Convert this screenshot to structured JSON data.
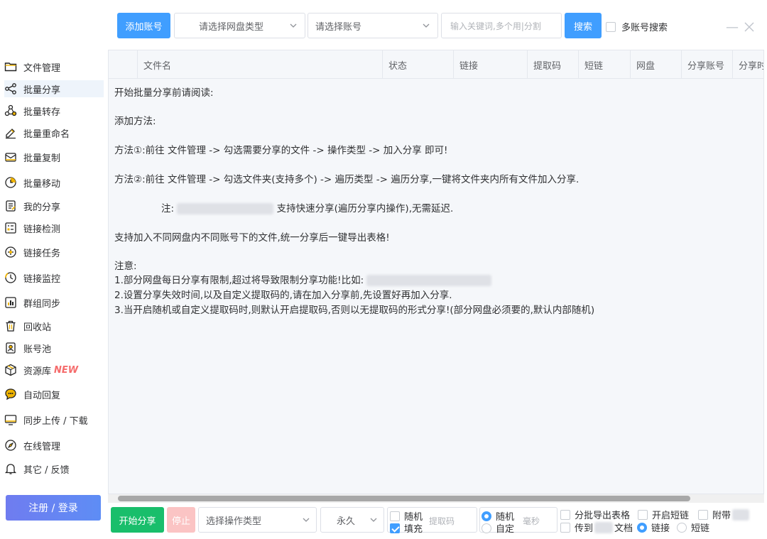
{
  "toolbar": {
    "add_account": "添加账号",
    "disk_type_placeholder": "请选择网盘类型",
    "account_placeholder": "请选择账号",
    "keyword_placeholder": "输入关键词,多个用|分割",
    "search": "搜索",
    "multi_account_search": "多账号搜索"
  },
  "sidebar": {
    "items": [
      {
        "label": "文件管理",
        "icon": "folder-icon"
      },
      {
        "label": "批量分享",
        "icon": "share-icon"
      },
      {
        "label": "批量转存",
        "icon": "transfer-icon"
      },
      {
        "label": "批量重命名",
        "icon": "rename-icon"
      },
      {
        "label": "批量复制",
        "icon": "copy-icon"
      },
      {
        "label": "批量移动",
        "icon": "move-icon"
      },
      {
        "label": "我的分享",
        "icon": "my-share-icon"
      },
      {
        "label": "链接检测",
        "icon": "link-check-icon"
      },
      {
        "label": "链接任务",
        "icon": "link-task-icon"
      },
      {
        "label": "链接监控",
        "icon": "link-monitor-icon"
      },
      {
        "label": "群组同步",
        "icon": "group-sync-icon"
      },
      {
        "label": "回收站",
        "icon": "trash-icon"
      },
      {
        "label": "账号池",
        "icon": "account-pool-icon"
      },
      {
        "label": "资源库",
        "icon": "resource-icon",
        "badge": "NEW"
      },
      {
        "label": "自动回复",
        "icon": "auto-reply-icon"
      },
      {
        "label": "同步上传 / 下载",
        "icon": "sync-icon"
      },
      {
        "label": "在线管理",
        "icon": "online-icon"
      },
      {
        "label": "其它 / 反馈",
        "icon": "bell-icon"
      }
    ],
    "login": "注册 / 登录"
  },
  "table": {
    "columns": [
      "文件名",
      "状态",
      "链接",
      "提取码",
      "短链",
      "网盘",
      "分享账号",
      "分享时"
    ]
  },
  "content": {
    "intro": "开始批量分享前请阅读:",
    "add_method": "添加方法:",
    "method1": "方法①:前往 文件管理 -> 勾选需要分享的文件 -> 操作类型 -> 加入分享 即可!",
    "method2": "方法②:前往 文件管理 -> 勾选文件夹(支持多个) -> 遍历类型 -> 遍历分享,一键将文件夹内所有文件加入分享.",
    "note_prefix": "注:",
    "note_suffix": "支持快速分享(遍历分享内操作),无需延迟.",
    "support": "支持加入不同网盘内不同账号下的文件,统一分享后一键导出表格!",
    "attention": "注意:",
    "line1": "1.部分网盘每日分享有限制,超过将导致限制分享功能!比如:",
    "line2": "2.设置分享失效时间,以及自定义提取码的,请在加入分享前,先设置好再加入分享.",
    "line3": "3.当开启随机或自定义提取码时,则默认开启提取码,否则以无提取码的形式分享!(部分网盘必须要的,默认内部随机)"
  },
  "bottom": {
    "start": "开始分享",
    "stop": "停止",
    "op_type_placeholder": "选择操作类型",
    "expire": "永久",
    "random": "随机",
    "fill": "填充",
    "code_placeholder": "提取码",
    "random2": "随机",
    "custom": "自定",
    "ms_placeholder": "毫秒",
    "batch_export": "分批导出表格",
    "open_short": "开启短链",
    "attach": "附带",
    "send_to": "传到",
    "doc": "文档",
    "link": "链接",
    "short_link": "短链"
  }
}
